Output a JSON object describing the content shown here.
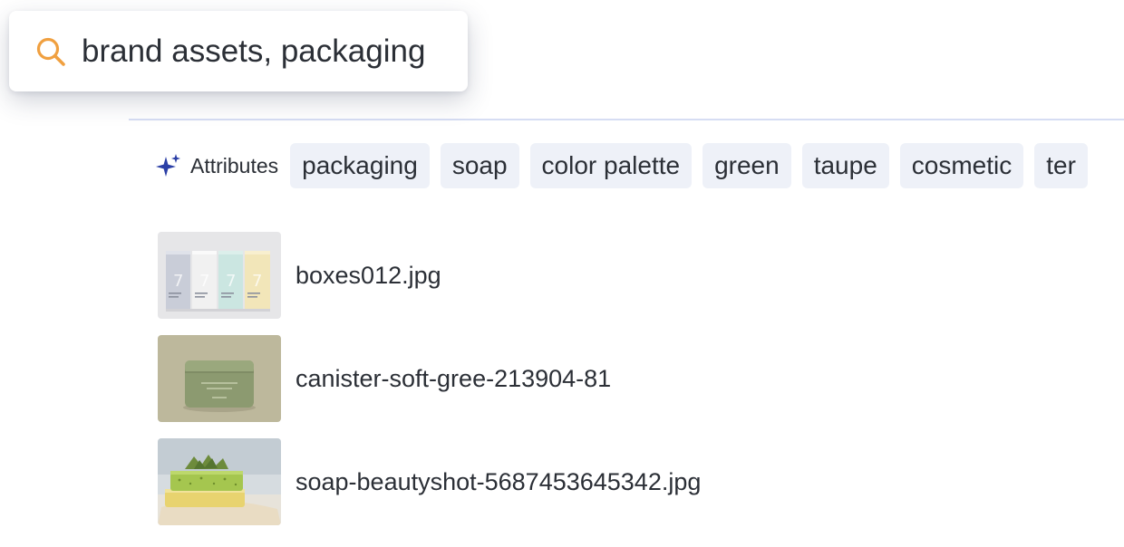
{
  "search": {
    "query": "brand assets, packaging",
    "icon": "search-icon",
    "icon_color": "#f0a040"
  },
  "attributes": {
    "label": "Attributes",
    "icon": "sparkle-icon",
    "icon_color": "#2b3fa6",
    "chips": [
      "packaging",
      "soap",
      "color palette",
      "green",
      "taupe",
      "cosmetic",
      "ter"
    ]
  },
  "results": [
    {
      "name": "boxes012.jpg",
      "thumbnail": "packaging-boxes"
    },
    {
      "name": "canister-soft-gree-213904-81",
      "thumbnail": "green-canister"
    },
    {
      "name": "soap-beautyshot-5687453645342.jpg",
      "thumbnail": "soap-bars"
    }
  ]
}
